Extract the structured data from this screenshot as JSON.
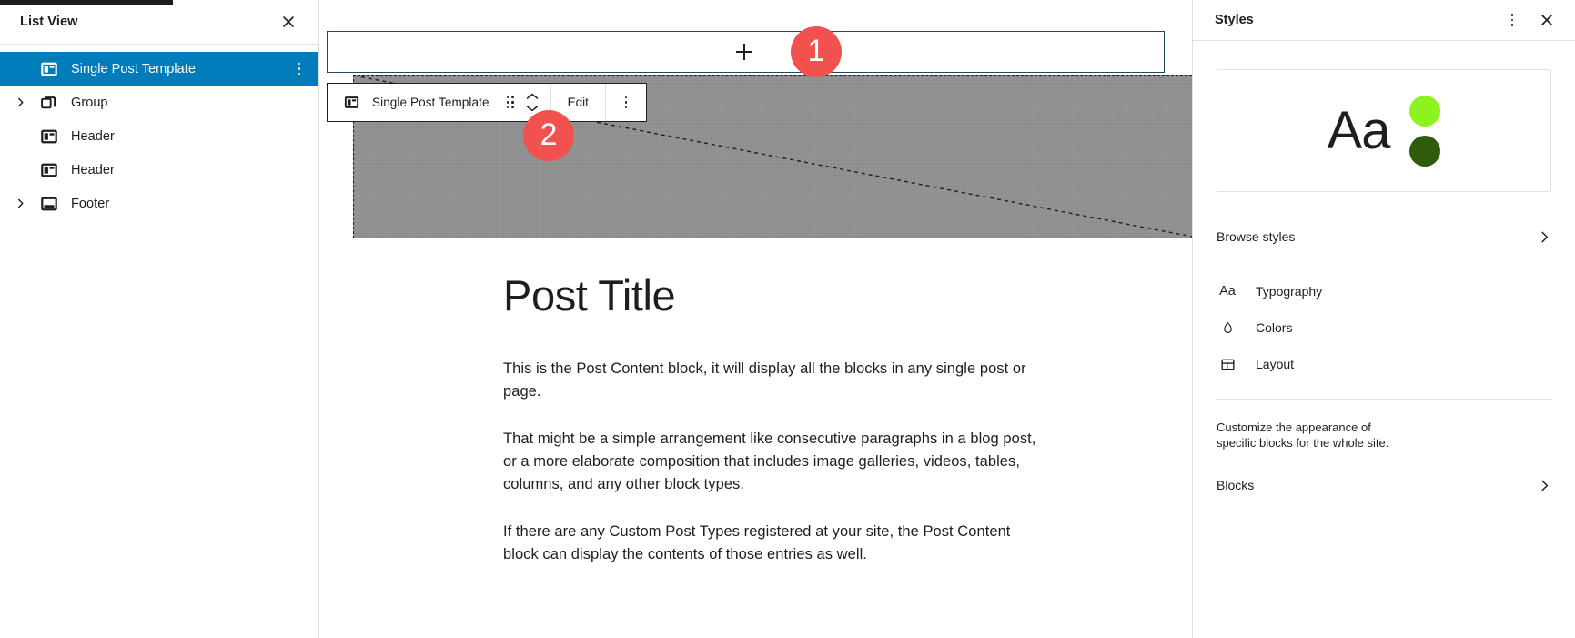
{
  "list_view": {
    "title": "List View",
    "close_icon": "close-icon",
    "items": [
      {
        "label": "Single Post Template",
        "icon": "template-part-icon",
        "expandable": false,
        "selected": true,
        "has_menu": true
      },
      {
        "label": "Group",
        "icon": "group-icon",
        "expandable": true,
        "selected": false,
        "has_menu": false
      },
      {
        "label": "Header",
        "icon": "template-part-icon",
        "expandable": false,
        "selected": false,
        "has_menu": false
      },
      {
        "label": "Header",
        "icon": "template-part-icon",
        "expandable": false,
        "selected": false,
        "has_menu": false
      },
      {
        "label": "Footer",
        "icon": "footer-icon",
        "expandable": true,
        "selected": false,
        "has_menu": false
      }
    ],
    "selected_bg": "#007cba"
  },
  "canvas": {
    "appender": {
      "icon": "plus-icon",
      "label": ""
    },
    "block_toolbar": {
      "block_icon": "template-part-icon",
      "block_name": "Single Post Template",
      "drag_handle_icon": "drag-handle-icon",
      "move_up_icon": "chevron-up-icon",
      "move_down_icon": "chevron-down-icon",
      "edit_label": "Edit",
      "options_icon": "kebab-vertical-icon"
    },
    "placeholder": {
      "label": "",
      "fill_color": "#939393"
    },
    "post": {
      "title": "Post Title",
      "paragraphs": [
        "This is the Post Content block, it will display all the blocks in any single post or page.",
        "That might be a simple arrangement like consecutive paragraphs in a blog post, or a more elaborate composition that includes image galleries, videos, tables, columns, and any other block types.",
        "If there are any Custom Post Types registered at your site, the Post Content block can display the contents of those entries as well."
      ]
    }
  },
  "annotations": {
    "badge_color": "#f1514f",
    "steps": [
      {
        "number": "1"
      },
      {
        "number": "2"
      }
    ]
  },
  "styles_panel": {
    "title": "Styles",
    "more_icon": "kebab-vertical-icon",
    "close_icon": "close-icon",
    "preview": {
      "sample_text": "Aa",
      "colors": [
        "#8ef220",
        "#2e5c0a"
      ]
    },
    "browse_styles": {
      "label": "Browse styles",
      "chevron": "chevron-right-icon"
    },
    "menu": [
      {
        "label": "Typography",
        "icon": "typography-icon"
      },
      {
        "label": "Colors",
        "icon": "color-drop-icon"
      },
      {
        "label": "Layout",
        "icon": "layout-icon"
      }
    ],
    "description": "Customize the appearance of specific blocks for the whole site.",
    "blocks_link": {
      "label": "Blocks",
      "chevron": "chevron-right-icon"
    }
  }
}
